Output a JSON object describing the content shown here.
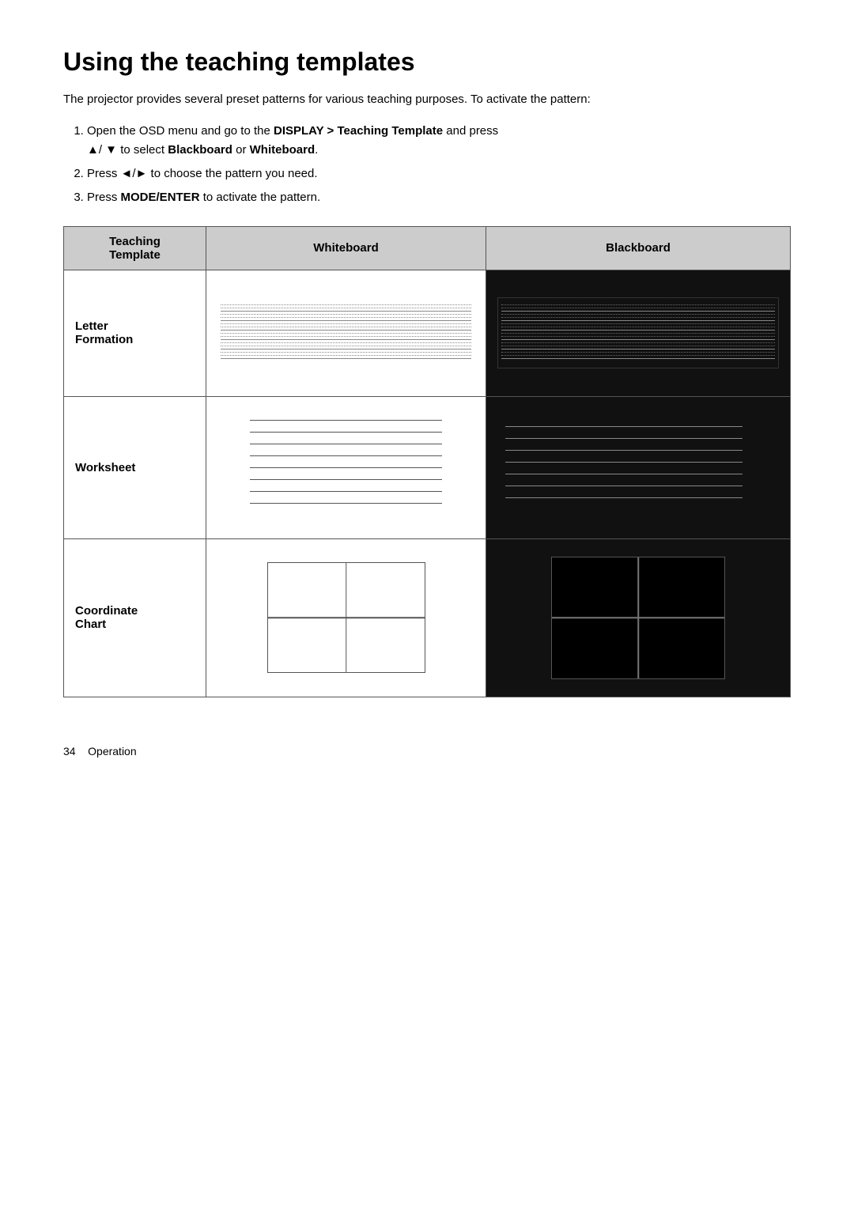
{
  "page": {
    "title": "Using the teaching templates",
    "intro": "The projector provides several preset patterns for various teaching purposes. To activate the pattern:",
    "steps": [
      {
        "id": 1,
        "text_plain": "Open the OSD menu and go to the ",
        "bold1": "DISPLAY > Teaching Template",
        "text_mid": " and press ▲/ ▼ to select ",
        "bold2": "Blackboard",
        "text_or": " or ",
        "bold3": "Whiteboard",
        "text_end": "."
      },
      {
        "id": 2,
        "text_plain": "Press ◄/► to choose the pattern you need."
      },
      {
        "id": 3,
        "text_plain": "Press ",
        "bold1": "MODE/ENTER",
        "text_end": " to activate the pattern."
      }
    ],
    "table": {
      "headers": {
        "template_col": "Teaching\nTemplate",
        "whiteboard_col": "Whiteboard",
        "blackboard_col": "Blackboard"
      },
      "rows": [
        {
          "label_line1": "Letter",
          "label_line2": "Formation"
        },
        {
          "label_line1": "Worksheet"
        },
        {
          "label_line1": "Coordinate",
          "label_line2": "Chart"
        }
      ]
    },
    "footer": {
      "page_number": "34",
      "section": "Operation"
    }
  }
}
